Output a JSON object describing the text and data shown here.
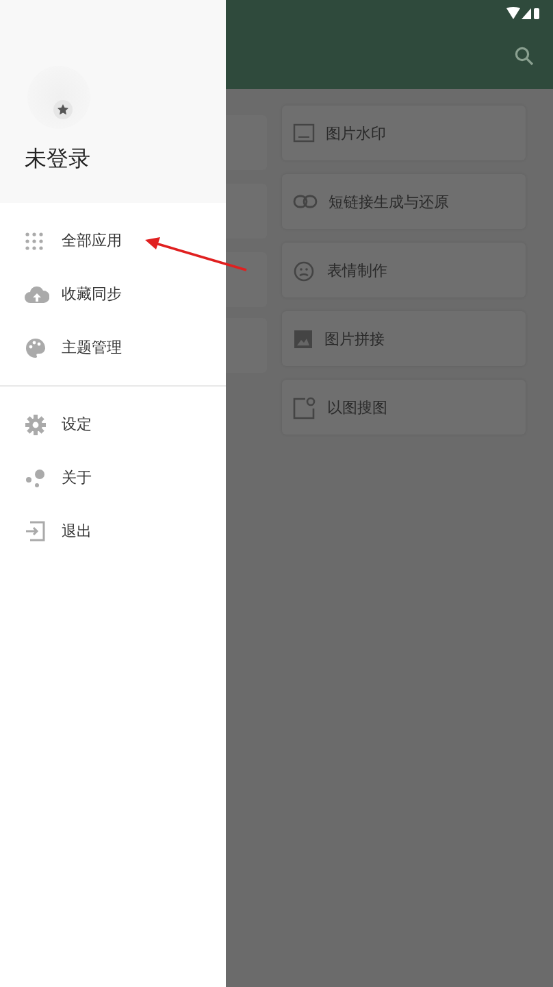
{
  "drawer": {
    "user_name": "未登录",
    "menu_groups": [
      [
        {
          "label": "全部应用"
        },
        {
          "label": "收藏同步"
        },
        {
          "label": "主题管理"
        }
      ],
      [
        {
          "label": "设定"
        },
        {
          "label": "关于"
        },
        {
          "label": "退出"
        }
      ]
    ]
  },
  "tools": [
    {
      "label": "图片水印"
    },
    {
      "label": "短链接生成与还原"
    },
    {
      "label": "表情制作"
    },
    {
      "label": "图片拼接"
    },
    {
      "label": "以图搜图"
    }
  ]
}
